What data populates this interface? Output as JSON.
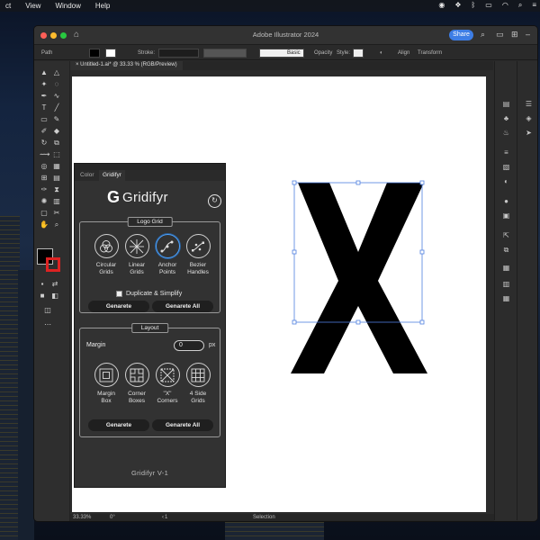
{
  "menubar": {
    "items": [
      "ct",
      "View",
      "Window",
      "Help"
    ],
    "status_icons": [
      "record-icon",
      "dropbox-icon",
      "bluetooth-icon",
      "battery-icon",
      "wifi-icon",
      "search-icon",
      "control-center-icon"
    ]
  },
  "window": {
    "title": "Adobe Illustrator 2024",
    "share_label": "Share",
    "control_bar": {
      "object_type": "Path",
      "stroke_label": "Stroke:",
      "brush_label": "Basic",
      "opacity_label": "Opacity",
      "style_label": "Style:",
      "align_label": "Align",
      "transform_label": "Transform"
    },
    "doc_tab": "Untitled-1.ai* @ 33.33 % (RGB/Preview)",
    "status": {
      "zoom": "33.33%",
      "rotation": "0°",
      "artboard_number": "1",
      "tool_name": "Selection"
    }
  },
  "artboard": {
    "glyph": "X",
    "fill_color": "#000000",
    "selection_color": "#4f7fe0"
  },
  "panel": {
    "tabs": [
      "Color",
      "Gridifyr"
    ],
    "active_tab": "Gridifyr",
    "logo_mark": "G",
    "logo_text": "Gridifyr",
    "logo_grid": {
      "title": "Logo Grid",
      "options": [
        {
          "label1": "Circular",
          "label2": "Grids",
          "icon": "circular-grid-icon"
        },
        {
          "label1": "Linear",
          "label2": "Grids",
          "icon": "linear-grid-icon"
        },
        {
          "label1": "Anchor",
          "label2": "Points",
          "icon": "anchor-points-icon"
        },
        {
          "label1": "Bezier",
          "label2": "Handles",
          "icon": "bezier-handles-icon"
        }
      ],
      "selected_option": "Anchor Points",
      "checkbox_label": "Duplicate & Simplify",
      "generate_label": "Genarete",
      "generate_all_label": "Genarete All"
    },
    "layout": {
      "title": "Layout",
      "margin_label": "Margin",
      "margin_value": "0",
      "margin_unit": "px",
      "options": [
        {
          "label1": "Margin",
          "label2": "Box",
          "icon": "margin-box-icon"
        },
        {
          "label1": "Corner",
          "label2": "Boxes",
          "icon": "corner-boxes-icon"
        },
        {
          "label1": "\"X\"",
          "label2": "Corners",
          "icon": "x-corners-icon"
        },
        {
          "label1": "4 Side",
          "label2": "Grids",
          "icon": "four-side-grids-icon"
        }
      ],
      "generate_label": "Genarete",
      "generate_all_label": "Genarete All"
    },
    "version": "Gridifyr V-1"
  },
  "colors": {
    "accent": "#3d7de5",
    "panel_bg": "#323232",
    "selected_ring": "#4da3ff"
  }
}
